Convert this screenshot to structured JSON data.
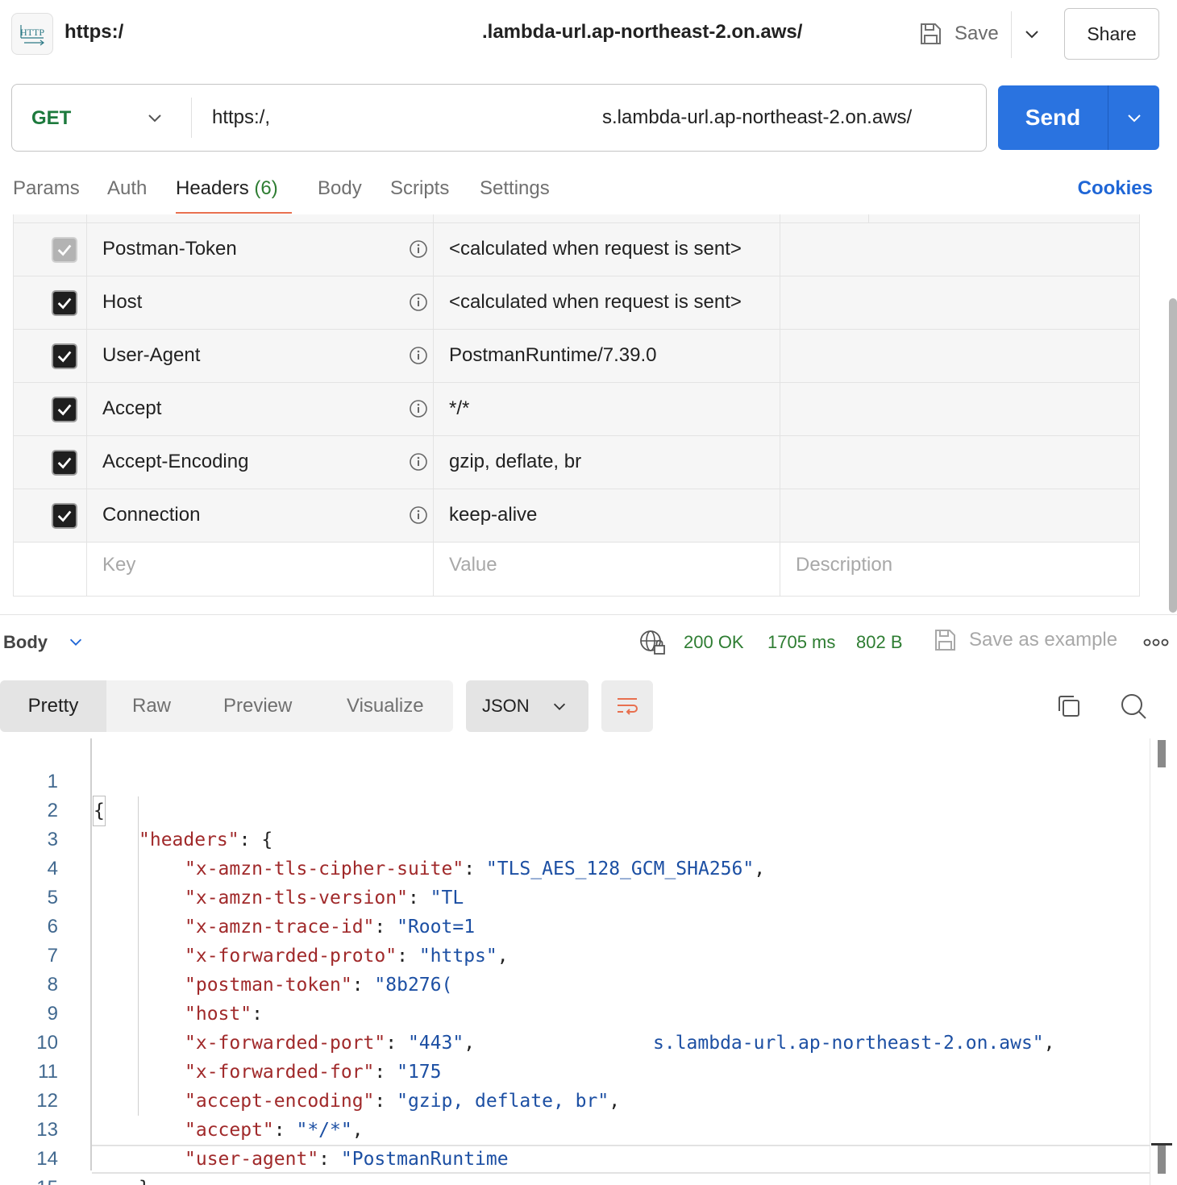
{
  "topbar": {
    "badge": "HTTP",
    "title_left": "https:/",
    "title_right": ".lambda-url.ap-northeast-2.on.aws/",
    "save_label": "Save",
    "share_label": "Share"
  },
  "request": {
    "method": "GET",
    "url_left": "https:/,",
    "url_right": "s.lambda-url.ap-northeast-2.on.aws/",
    "send_label": "Send"
  },
  "tabs": [
    {
      "label": "Params"
    },
    {
      "label": "Auth"
    },
    {
      "label": "Headers",
      "count": "(6)"
    },
    {
      "label": "Body"
    },
    {
      "label": "Scripts"
    },
    {
      "label": "Settings"
    }
  ],
  "cookies_label": "Cookies",
  "headers_table": {
    "rows": [
      {
        "key": "Postman-Token",
        "value": "<calculated when request is sent>",
        "checked": true,
        "disabled": true
      },
      {
        "key": "Host",
        "value": "<calculated when request is sent>",
        "checked": true,
        "disabled": false
      },
      {
        "key": "User-Agent",
        "value": "PostmanRuntime/7.39.0",
        "checked": true,
        "disabled": false
      },
      {
        "key": "Accept",
        "value": "*/*",
        "checked": true,
        "disabled": false
      },
      {
        "key": "Accept-Encoding",
        "value": "gzip, deflate, br",
        "checked": true,
        "disabled": false
      },
      {
        "key": "Connection",
        "value": "keep-alive",
        "checked": true,
        "disabled": false
      }
    ],
    "placeholder_key": "Key",
    "placeholder_value": "Value",
    "placeholder_description": "Description"
  },
  "response": {
    "body_label": "Body",
    "status": "200 OK",
    "time": "1705 ms",
    "size": "802 B",
    "save_example_label": "Save as example",
    "view_tabs": [
      "Pretty",
      "Raw",
      "Preview",
      "Visualize"
    ],
    "format": "JSON"
  },
  "code_lines": [
    {
      "n": "1",
      "indent": 0,
      "text": "{"
    },
    {
      "n": "2",
      "indent": 1,
      "key": "\"headers\"",
      "rest": ": {"
    },
    {
      "n": "3",
      "indent": 2,
      "key": "\"x-amzn-tls-cipher-suite\"",
      "sep": ": ",
      "val": "\"TLS_AES_128_GCM_SHA256\"",
      "tail": ","
    },
    {
      "n": "4",
      "indent": 2,
      "key": "\"x-amzn-tls-version\"",
      "sep": ": ",
      "val": "\"TL"
    },
    {
      "n": "5",
      "indent": 2,
      "key": "\"x-amzn-trace-id\"",
      "sep": ": ",
      "val": "\"Root=1"
    },
    {
      "n": "6",
      "indent": 2,
      "key": "\"x-forwarded-proto\"",
      "sep": ": ",
      "val": "\"https\"",
      "tail": ","
    },
    {
      "n": "7",
      "indent": 2,
      "key": "\"postman-token\"",
      "sep": ": ",
      "val": "\"8b276("
    },
    {
      "n": "8",
      "indent": 2,
      "key": "\"host\"",
      "sep": ":",
      "val": "s.lambda-url.ap-northeast-2.on.aws\"",
      "tail": ","
    },
    {
      "n": "9",
      "indent": 2,
      "key": "\"x-forwarded-port\"",
      "sep": ": ",
      "val": "\"443\"",
      "tail": ","
    },
    {
      "n": "10",
      "indent": 2,
      "key": "\"x-forwarded-for\"",
      "sep": ": ",
      "val": "\"175"
    },
    {
      "n": "11",
      "indent": 2,
      "key": "\"accept-encoding\"",
      "sep": ": ",
      "val": "\"gzip, deflate, br\"",
      "tail": ","
    },
    {
      "n": "12",
      "indent": 2,
      "key": "\"accept\"",
      "sep": ": ",
      "val": "\"*/*\"",
      "tail": ","
    },
    {
      "n": "13",
      "indent": 2,
      "key": "\"user-agent\"",
      "sep": ": ",
      "val": "\"PostmanRuntime"
    },
    {
      "n": "14",
      "indent": 1,
      "text": "}"
    },
    {
      "n": "15",
      "indent": 0,
      "text": "}"
    }
  ],
  "colors": {
    "accent": "#2a73e0",
    "method_green": "#1d7a3d",
    "status_green": "#2e7d32",
    "tab_underline": "#e8704f",
    "json_key": "#a0292a",
    "json_string": "#1c4fa3"
  }
}
